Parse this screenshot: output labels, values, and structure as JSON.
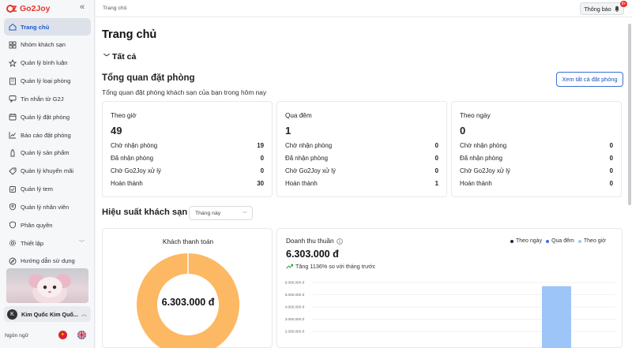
{
  "sidebar": {
    "brand": "Go2Joy",
    "collapse_icon": "«",
    "items": [
      {
        "label": "Trang chủ",
        "icon": "home-icon",
        "active": true
      },
      {
        "label": "Nhóm khách sạn",
        "icon": "grid-icon"
      },
      {
        "label": "Quản lý bình luận",
        "icon": "star-icon"
      },
      {
        "label": "Quản lý loại phòng",
        "icon": "building-icon"
      },
      {
        "label": "Tin nhắn từ G2J",
        "icon": "message-icon"
      },
      {
        "label": "Quản lý đặt phòng",
        "icon": "calendar-icon"
      },
      {
        "label": "Báo cáo đặt phòng",
        "icon": "chart-icon"
      },
      {
        "label": "Quản lý sản phẩm",
        "icon": "bottle-icon"
      },
      {
        "label": "Quản lý khuyến mãi",
        "icon": "tag-icon"
      },
      {
        "label": "Quản lý tem",
        "icon": "stamp-icon"
      },
      {
        "label": "Quản lý nhân viên",
        "icon": "user-shield-icon"
      },
      {
        "label": "Phân quyền",
        "icon": "shield-icon"
      },
      {
        "label": "Thiết lập",
        "icon": "gear-icon",
        "has_children": true
      },
      {
        "label": "Hướng dẫn sử dụng",
        "icon": "compass-icon"
      }
    ],
    "account": {
      "initial": "K",
      "name": "Kim Quốc Kim Quố..."
    },
    "language_label": "Ngôn ngữ"
  },
  "header": {
    "breadcrumb": "Trang chủ",
    "notifications_label": "Thông báo",
    "notifications_badge": "9+"
  },
  "page": {
    "title": "Trang chủ",
    "section_label": "Tất cả",
    "booking_overview": {
      "title": "Tổng quan đặt phòng",
      "subtitle": "Tổng quan đặt phòng khách sạn của bạn trong hôm nay",
      "view_all_label": "Xem tất cả đặt phòng",
      "cards": [
        {
          "title": "Theo giờ",
          "total": "49",
          "rows": [
            {
              "label": "Chờ nhận phòng",
              "value": "19"
            },
            {
              "label": "Đã nhận phòng",
              "value": "0"
            },
            {
              "label": "Chờ Go2Joy xử lý",
              "value": "0"
            },
            {
              "label": "Hoàn thành",
              "value": "30"
            }
          ]
        },
        {
          "title": "Qua đêm",
          "total": "1",
          "rows": [
            {
              "label": "Chờ nhận phòng",
              "value": "0"
            },
            {
              "label": "Đã nhận phòng",
              "value": "0"
            },
            {
              "label": "Chờ Go2Joy xử lý",
              "value": "0"
            },
            {
              "label": "Hoàn thành",
              "value": "1"
            }
          ]
        },
        {
          "title": "Theo ngày",
          "total": "0",
          "rows": [
            {
              "label": "Chờ nhận phòng",
              "value": "0"
            },
            {
              "label": "Đã nhận phòng",
              "value": "0"
            },
            {
              "label": "Chờ Go2Joy xử lý",
              "value": "0"
            },
            {
              "label": "Hoàn thành",
              "value": "0"
            }
          ]
        }
      ]
    },
    "performance": {
      "title": "Hiệu suất khách sạn",
      "period_value": "Tháng này"
    }
  },
  "colors": {
    "accent": "#1d57c8",
    "donut": "#fdb863",
    "bar": "#9ec5f7",
    "series_day": "#1e2a44",
    "series_overnight": "#3d6fd8",
    "series_hour": "#9ec5f7",
    "trend_up": "#2e9a44"
  },
  "chart_data": [
    {
      "type": "pie",
      "title": "Khách thanh toán",
      "center_label": "6.303.000 đ",
      "values": [
        6303000
      ]
    },
    {
      "type": "bar",
      "title": "Doanh thu thuần",
      "value_label": "6.303.000 đ",
      "trend_label": "Tăng 1136% so với tháng trước",
      "legend": [
        "Theo ngày",
        "Qua đêm",
        "Theo giờ"
      ],
      "ytick_labels": [
        "6.000.000 đ",
        "5.000.000 đ",
        "4.000.000 đ",
        "3.000.000 đ",
        "2.000.000 đ"
      ],
      "yticks": [
        6000000,
        5000000,
        4000000,
        3000000,
        2000000
      ],
      "series": [
        {
          "name": "Theo giờ",
          "values": [
            5700000
          ]
        }
      ],
      "ylim": [
        0,
        6500000
      ]
    }
  ]
}
